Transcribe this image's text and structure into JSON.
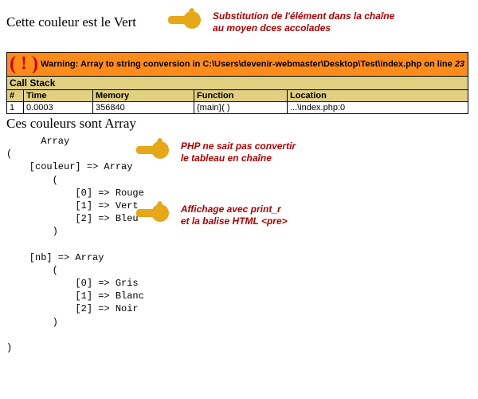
{
  "line1": "Cette couleur est le Vert",
  "annot1a": "Substitution de l'élément dans la chaîne",
  "annot1b": "au moyen dces accolades",
  "xdebug": {
    "warning_label": "Warning: Array to string conversion in ",
    "warning_path": "C:\\Users\\devenir-webmaster\\Desktop\\Test\\index.php",
    "warning_on": " on line ",
    "warning_line": "23",
    "callstack_label": "Call Stack",
    "headers": {
      "n": "#",
      "time": "Time",
      "memory": "Memory",
      "function": "Function",
      "location": "Location"
    },
    "row": {
      "n": "1",
      "time": "0.0003",
      "memory": "356840",
      "function": "{main}( )",
      "location": "...\\index.php:0"
    }
  },
  "line2": "Ces couleurs sont Array",
  "annot2a": "PHP ne sait pas convertir",
  "annot2b": "le tableau en chaîne",
  "annot3a": "Affichage avec print_r",
  "annot3b": "et la balise HTML <pre>",
  "dump": "      Array\n(\n    [couleur] => Array\n        (\n            [0] => Rouge\n            [1] => Vert\n            [2] => Bleu\n        )\n\n    [nb] => Array\n        (\n            [0] => Gris\n            [1] => Blanc\n            [2] => Noir\n        )\n\n)"
}
